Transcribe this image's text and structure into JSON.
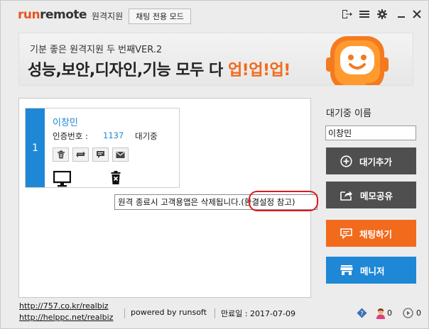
{
  "app": {
    "logo_run": "run",
    "logo_remote": "remote",
    "subtitle": "원격지원",
    "chat_mode_label": "채팅 전용 모드"
  },
  "titlebar_icons": [
    "exit-icon",
    "menu-icon",
    "gear-icon",
    "minimize-icon",
    "close-icon"
  ],
  "banner": {
    "line1": "기분 좋은 원격지원 두 번째VER.2",
    "line2_prefix": "성능,보안,디자인,기능 모두 다 ",
    "line2_highlight": "업!업!업!"
  },
  "queue": [
    {
      "index": "1",
      "name": "이창민",
      "auth_label": "인증번호 :",
      "auth_code": "1137",
      "status": "대기중",
      "actions": [
        "delete-icon",
        "transfer-icon",
        "chat-icon",
        "mail-icon"
      ]
    }
  ],
  "tooltip": {
    "text": "원격 종료시 고객용앱은 삭제됩니다.(환결설정 참고)"
  },
  "right": {
    "wait_label": "대기중 이름",
    "wait_input_value": "이창민",
    "add_label": "대기추가",
    "memo_label": "메모공유",
    "chat_label": "채팅하기",
    "manager_label": "메니저"
  },
  "colors": {
    "accent_orange": "#f26a1b",
    "accent_blue": "#1e88d6",
    "dark_button": "#4f4f4f",
    "tooltip_highlight": "#e0191d"
  },
  "footer": {
    "link1": "http://757.co.kr/realbiz",
    "link2": "http://helppc.net/realbiz",
    "powered": "powered by runsoft",
    "release": "만료일 : 2017-07-09",
    "users_count": "0",
    "next_count": "0"
  }
}
